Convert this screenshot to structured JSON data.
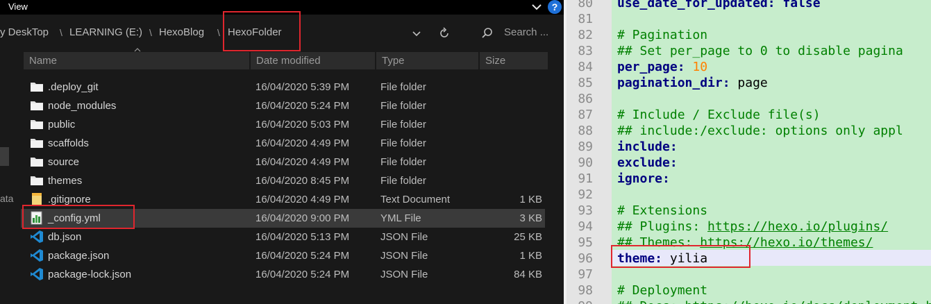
{
  "explorer": {
    "menu_view": "View",
    "help_label": "?",
    "breadcrumb": [
      "y DeskTop",
      "LEARNING (E:)",
      "HexoBlog",
      "HexoFolder"
    ],
    "breadcrumb_separator": "\\",
    "search_placeholder": "Search ...",
    "columns": [
      "Name",
      "Date modified",
      "Type",
      "Size"
    ],
    "left_nav_label": "ata",
    "rows": [
      {
        "name": ".deploy_git",
        "date": "16/04/2020 5:39 PM",
        "type": "File folder",
        "size": "",
        "icon": "folder-icon"
      },
      {
        "name": "node_modules",
        "date": "16/04/2020 5:24 PM",
        "type": "File folder",
        "size": "",
        "icon": "folder-icon"
      },
      {
        "name": "public",
        "date": "16/04/2020 5:03 PM",
        "type": "File folder",
        "size": "",
        "icon": "folder-icon"
      },
      {
        "name": "scaffolds",
        "date": "16/04/2020 4:49 PM",
        "type": "File folder",
        "size": "",
        "icon": "folder-icon"
      },
      {
        "name": "source",
        "date": "16/04/2020 4:49 PM",
        "type": "File folder",
        "size": "",
        "icon": "folder-icon"
      },
      {
        "name": "themes",
        "date": "16/04/2020 8:45 PM",
        "type": "File folder",
        "size": "",
        "icon": "folder-icon"
      },
      {
        "name": ".gitignore",
        "date": "16/04/2020 4:49 PM",
        "type": "Text Document",
        "size": "1 KB",
        "icon": "text-document-icon"
      },
      {
        "name": "_config.yml",
        "date": "16/04/2020 9:00 PM",
        "type": "YML File",
        "size": "3 KB",
        "icon": "yml-file-icon",
        "selected": true
      },
      {
        "name": "db.json",
        "date": "16/04/2020 5:13 PM",
        "type": "JSON File",
        "size": "25 KB",
        "icon": "vscode-file-icon"
      },
      {
        "name": "package.json",
        "date": "16/04/2020 5:24 PM",
        "type": "JSON File",
        "size": "1 KB",
        "icon": "vscode-file-icon"
      },
      {
        "name": "package-lock.json",
        "date": "16/04/2020 5:24 PM",
        "type": "JSON File",
        "size": "84 KB",
        "icon": "vscode-file-icon"
      }
    ]
  },
  "editor": {
    "lines": [
      {
        "n": "80",
        "text": "use_date_for_updated: false"
      },
      {
        "n": "81",
        "text": ""
      },
      {
        "n": "82",
        "text": "# Pagination"
      },
      {
        "n": "83",
        "text": "## Set per_page to 0 to disable pagina"
      },
      {
        "n": "84",
        "text": "per_page: 10"
      },
      {
        "n": "85",
        "text": "pagination_dir: page"
      },
      {
        "n": "86",
        "text": ""
      },
      {
        "n": "87",
        "text": "# Include / Exclude file(s)"
      },
      {
        "n": "88",
        "text": "## include:/exclude: options only appl"
      },
      {
        "n": "89",
        "text": "include:"
      },
      {
        "n": "90",
        "text": "exclude:"
      },
      {
        "n": "91",
        "text": "ignore:"
      },
      {
        "n": "92",
        "text": ""
      },
      {
        "n": "93",
        "text": "# Extensions"
      },
      {
        "n": "94",
        "text": "## Plugins: https://hexo.io/plugins/"
      },
      {
        "n": "95",
        "text": "## Themes: https://hexo.io/themes/"
      },
      {
        "n": "96",
        "text": "theme: yilia"
      },
      {
        "n": "97",
        "text": ""
      },
      {
        "n": "98",
        "text": "# Deployment"
      },
      {
        "n": "99",
        "text": "## Docs: https://hexo.io/docs/deployment.html"
      }
    ]
  },
  "colors": {
    "explorer_bg": "#191919",
    "editor_code_bg": "#c7edcc",
    "annotation_red": "#e0262e",
    "comment_green": "#008000",
    "keyword_navy": "#000080",
    "number_orange": "#ff8000"
  }
}
